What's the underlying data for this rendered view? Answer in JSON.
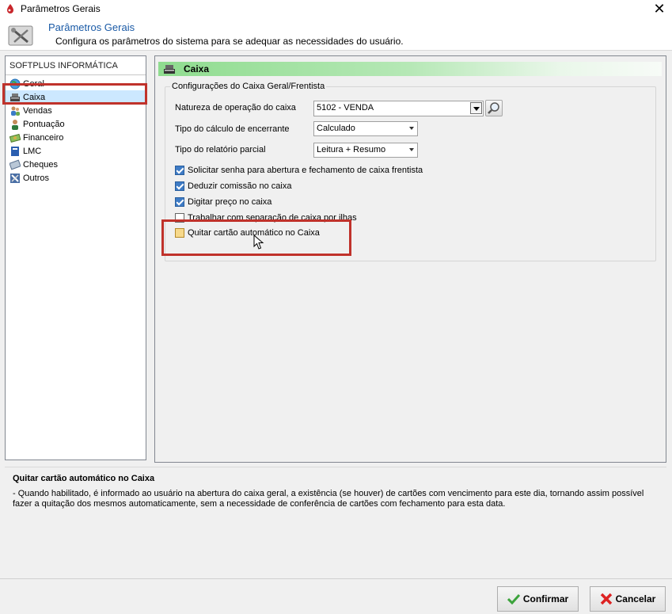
{
  "window": {
    "title": "Parâmetros Gerais",
    "close_glyph": "✕"
  },
  "header": {
    "title": "Parâmetros Gerais",
    "subtitle": "Configura os parâmetros do sistema para se adequar as necessidades do usuário."
  },
  "sidebar": {
    "heading": "SOFTPLUS INFORMÁTICA",
    "items": [
      {
        "label": "Geral",
        "icon": "globe-icon"
      },
      {
        "label": "Caixa",
        "icon": "cash-register-icon",
        "selected": true
      },
      {
        "label": "Vendas",
        "icon": "people-icon"
      },
      {
        "label": "Pontuação",
        "icon": "user-points-icon"
      },
      {
        "label": "Financeiro",
        "icon": "money-icon"
      },
      {
        "label": "LMC",
        "icon": "book-icon"
      },
      {
        "label": "Cheques",
        "icon": "cheque-icon"
      },
      {
        "label": "Outros",
        "icon": "tools-icon"
      }
    ]
  },
  "section": {
    "title": "Caixa",
    "group_title": "Configurações do Caixa Geral/Frentista",
    "natureza": {
      "label": "Natureza de operação do caixa",
      "value": "5102  - VENDA"
    },
    "calculo": {
      "label": "Tipo do cálculo de encerrante",
      "value": "Calculado"
    },
    "relatorio": {
      "label": "Tipo do relatório parcial",
      "value": "Leitura + Resumo"
    },
    "options": [
      {
        "label": "Solicitar senha para abertura e fechamento de caixa frentista",
        "checked": true
      },
      {
        "label": "Deduzir comissão no caixa",
        "checked": true
      },
      {
        "label": "Digitar preço no caixa",
        "checked": true
      },
      {
        "label": "Trabalhar com separação de caixa por ilhas",
        "checked": false
      },
      {
        "label": "Quitar cartão automático no Caixa",
        "checked": false
      }
    ]
  },
  "help": {
    "title": "Quitar cartão automático no Caixa",
    "text": "- Quando habilitado, é informado ao usuário na abertura do caixa geral, a existência (se houver) de cartões com vencimento para este dia, tornando assim possível fazer a quitação dos mesmos automaticamente, sem a necessidade de conferência de cartões com fechamento para esta data."
  },
  "buttons": {
    "confirm": "Confirmar",
    "cancel": "Cancelar"
  },
  "colors": {
    "highlight": "#c0322b",
    "section_bar": "#8fdc8f",
    "header_title": "#1a5aa6"
  }
}
